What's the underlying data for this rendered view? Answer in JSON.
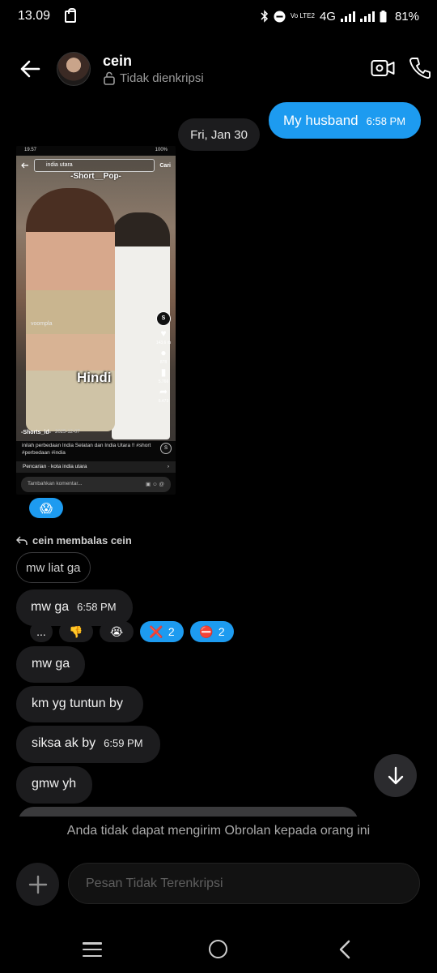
{
  "status_bar": {
    "time": "13.09",
    "network": "4G",
    "volte": "Vo LTE2",
    "battery": "81%"
  },
  "header": {
    "contact_name": "cein",
    "encryption_status": "Tidak dienkripsi",
    "icons": [
      "back-arrow-icon",
      "video-call-icon",
      "phone-icon",
      "lock-icon"
    ]
  },
  "outgoing_message": {
    "text": "My husband",
    "time": "6:58 PM"
  },
  "date_separator": "Fri, Jan 30",
  "shared_media": {
    "status_time": "19.57",
    "status_battery": "100%",
    "search_query": "india utara",
    "search_button": "Cari",
    "channel_overlay": "-Short__Pop-",
    "watermark": "voompla",
    "overlay_text": "Hindi",
    "author": "-Shorts_id-",
    "post_date": "2025-12-07",
    "likes": "143,6 rb",
    "comments": "878",
    "saves": "5.766",
    "shares": "6.473",
    "caption": "inilah perbedaan India Selatan dan India Utara !! #short #perbedaan #india",
    "related_search": "Pencarian · kota india utara",
    "comment_placeholder": "Tambahkan komentar..."
  },
  "media_reaction": "😱",
  "reply": {
    "meta": "cein membalas cein",
    "quoted": "mw liat ga"
  },
  "messages_in": [
    {
      "text": "mw ga",
      "time": "6:58 PM"
    },
    {
      "text": "mw ga",
      "time": ""
    },
    {
      "text": "km yg tuntun by",
      "time": ""
    },
    {
      "text": "siksa ak by",
      "time": "6:59 PM"
    },
    {
      "text": "gmw yh",
      "time": ""
    }
  ],
  "reactions": [
    {
      "emoji": "...",
      "count": "",
      "mine": false
    },
    {
      "emoji": "👎",
      "count": "",
      "mine": false
    },
    {
      "emoji": "😭",
      "count": "",
      "mine": false
    },
    {
      "emoji": "❌",
      "count": "2",
      "mine": true
    },
    {
      "emoji": "⛔",
      "count": "2",
      "mine": true
    }
  ],
  "footer": {
    "notice": "Anda tidak dapat mengirim Obrolan kepada orang ini",
    "composer_placeholder": "Pesan Tidak Terenkripsi"
  },
  "colors": {
    "accent": "#1d9bf0",
    "incoming_bubble": "#1c1c1e",
    "background": "#000000"
  }
}
